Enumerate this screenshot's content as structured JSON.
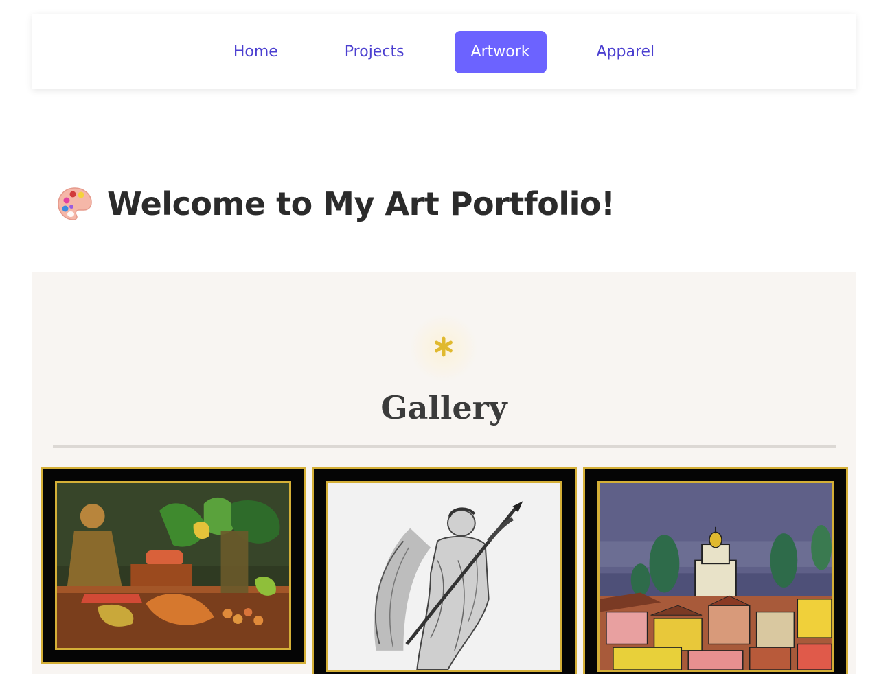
{
  "nav": {
    "items": [
      {
        "label": "Home",
        "active": false
      },
      {
        "label": "Projects",
        "active": false
      },
      {
        "label": "Artwork",
        "active": true
      },
      {
        "label": "Apparel",
        "active": false
      }
    ]
  },
  "hero": {
    "icon": "palette-icon",
    "title": "Welcome to My Art Portfolio!"
  },
  "gallery": {
    "icon": "sparkle-star-icon",
    "title": "Gallery",
    "artworks": [
      {
        "subject": "still-life painting"
      },
      {
        "subject": "angel sculpture drawing"
      },
      {
        "subject": "city rooftops watercolor"
      }
    ]
  },
  "colors": {
    "accent": "#6c63ff",
    "nav_text": "#4b3fd0",
    "frame_gold": "#d4af37",
    "gallery_bg": "#f8f5f2",
    "star": "#e0b92f"
  }
}
